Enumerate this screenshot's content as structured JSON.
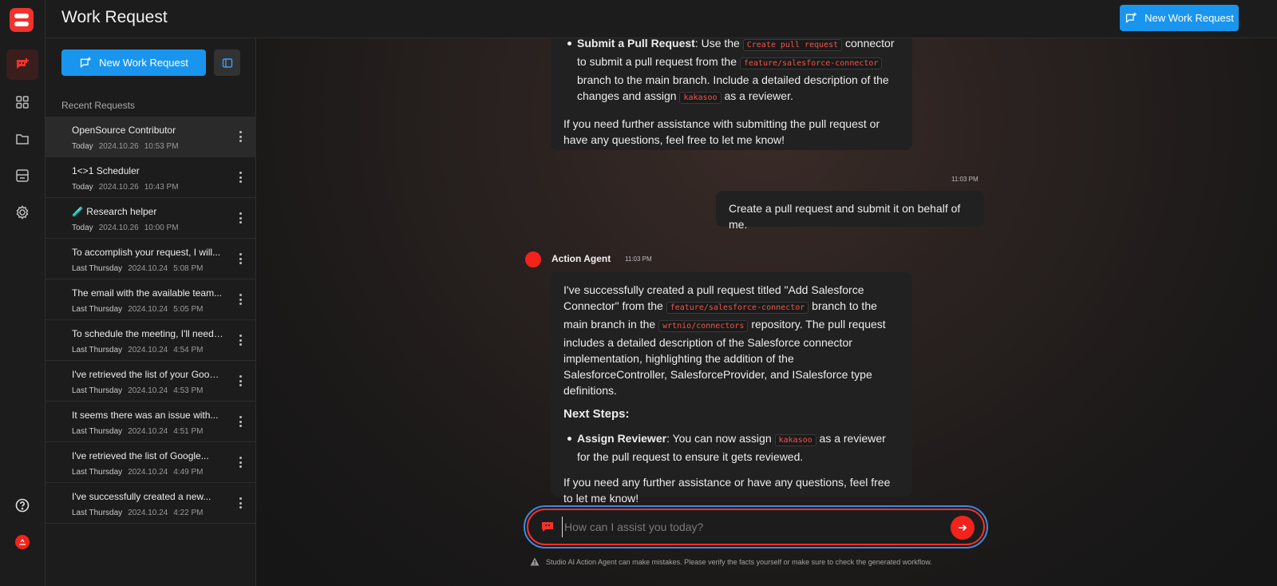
{
  "header": {
    "title": "Work Request",
    "new_request_label": "New Work Request"
  },
  "sidebar": {
    "new_request_label": "New Work Request",
    "section_label": "Recent Requests",
    "items": [
      {
        "title": "OpenSource Contributor",
        "day": "Today",
        "date": "2024.10.26",
        "time": "10:53 PM",
        "active": true
      },
      {
        "title": "1<>1 Scheduler",
        "day": "Today",
        "date": "2024.10.26",
        "time": "10:43 PM"
      },
      {
        "title": "🧪 Research helper",
        "day": "Today",
        "date": "2024.10.26",
        "time": "10:00 PM"
      },
      {
        "title": "To accomplish your request, I will...",
        "day": "Last Thursday",
        "date": "2024.10.24",
        "time": "5:08 PM"
      },
      {
        "title": "The email with the available team...",
        "day": "Last Thursday",
        "date": "2024.10.24",
        "time": "5:05 PM"
      },
      {
        "title": "To schedule the meeting, I'll need ...",
        "day": "Last Thursday",
        "date": "2024.10.24",
        "time": "4:54 PM"
      },
      {
        "title": "I've retrieved the list of your Googl...",
        "day": "Last Thursday",
        "date": "2024.10.24",
        "time": "4:53 PM"
      },
      {
        "title": "It seems there was an issue with...",
        "day": "Last Thursday",
        "date": "2024.10.24",
        "time": "4:51 PM"
      },
      {
        "title": "I've retrieved the list of Google...",
        "day": "Last Thursday",
        "date": "2024.10.24",
        "time": "4:49 PM"
      },
      {
        "title": "I've successfully created a new...",
        "day": "Last Thursday",
        "date": "2024.10.24",
        "time": "4:22 PM"
      }
    ]
  },
  "chat": {
    "prev_bullet_strong": "Submit a Pull Request",
    "prev_bullet_t1": ": Use the ",
    "prev_bullet_code1": "Create pull request",
    "prev_bullet_t2": " connector to submit a pull request from the ",
    "prev_bullet_code2": "feature/salesforce-connector",
    "prev_bullet_t3": " branch to the main branch. Include a detailed description of the changes and assign ",
    "prev_bullet_code3": "kakasoo",
    "prev_bullet_t4": " as a reviewer.",
    "prev_closing": "If you need further assistance with submitting the pull request or have any questions, feel free to let me know!",
    "user_time": "11:03 PM",
    "user_message": "Create a pull request and submit it on behalf of me.",
    "agent_name": "Action Agent",
    "agent_time": "11:03 PM",
    "reply_t1": "I've successfully created a pull request titled \"Add Salesforce Connector\" from the ",
    "reply_code1": "feature/salesforce-connector",
    "reply_t2": " branch to the main branch in the ",
    "reply_code2": "wrtnio/connectors",
    "reply_t3": " repository. The pull request includes a detailed description of the Salesforce connector implementation, highlighting the addition of the SalesforceController, SalesforceProvider, and ISalesforce type definitions.",
    "next_steps_heading": "Next Steps:",
    "step_strong": "Assign Reviewer",
    "step_t1": ": You can now assign ",
    "step_code": "kakasoo",
    "step_t2": " as a reviewer for the pull request to ensure it gets reviewed.",
    "reply_closing": "If you need any further assistance or have any questions, feel free to let me know!"
  },
  "composer": {
    "placeholder": "How can I assist you today?",
    "disclaimer": "Studio AI Action Agent can make mistakes. Please verify the facts yourself or make sure to check the generated workflow."
  },
  "colors": {
    "accent_red": "#f3322b",
    "primary_blue": "#1a95ee"
  },
  "icons": {
    "rail": [
      "chat-plus-icon",
      "grid-icon",
      "folder-icon",
      "store-icon",
      "gear-icon",
      "help-icon",
      "user-avatar-icon"
    ]
  }
}
